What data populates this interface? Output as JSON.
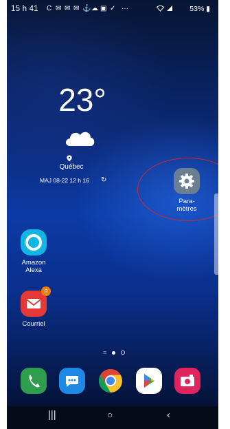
{
  "status_bar": {
    "time": "15 h 41",
    "ellipsis": "···",
    "battery_text": "53%"
  },
  "weather": {
    "temperature": "23°",
    "city": "Québec",
    "updated": "MAJ 08-22 12 h 16"
  },
  "apps": {
    "settings_label": "Para-\nmètres",
    "alexa_label": "Amazon\nAlexa",
    "mail_label": "Courriel",
    "mail_badge": "8"
  },
  "dock": [
    "phone-icon",
    "messages-icon",
    "chrome-icon",
    "play-store-icon",
    "camera-icon"
  ],
  "colors": {
    "annotation_ellipse": "#d12a2a",
    "alexa": "#12b6e2",
    "mail": "#e53935",
    "settings": "#6b7f93"
  }
}
